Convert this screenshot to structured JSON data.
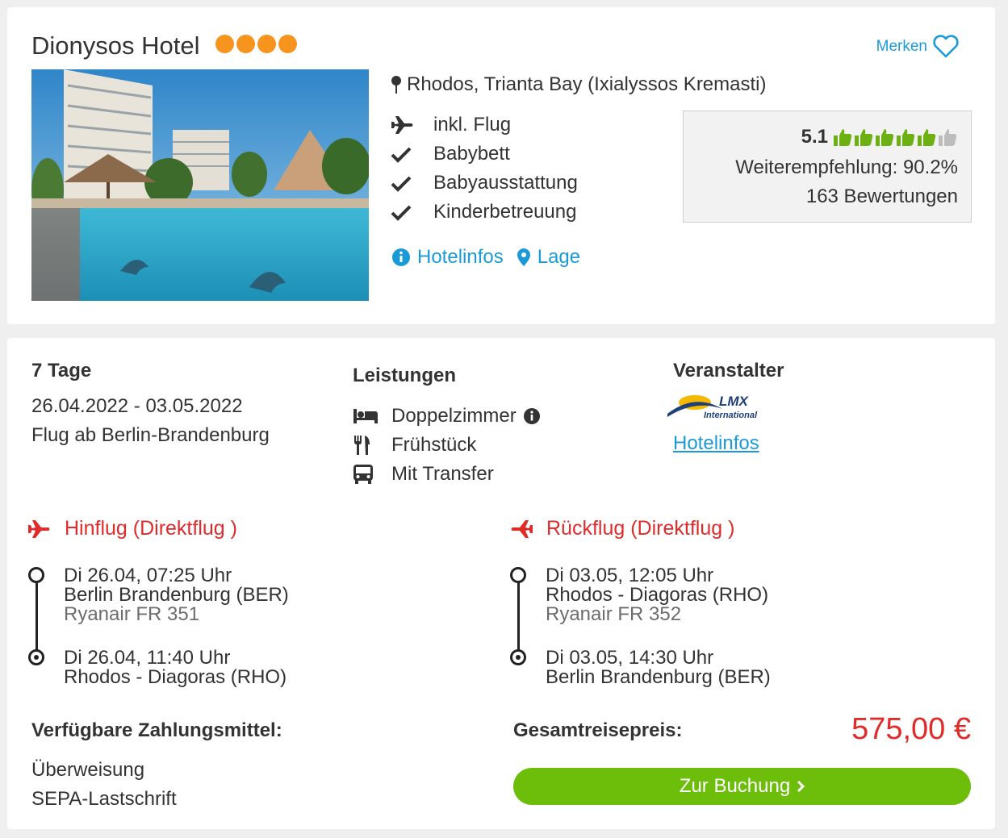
{
  "hotel": {
    "name": "Dionysos Hotel",
    "stars": 4,
    "merken_label": "Merken",
    "location": "Rhodos, Trianta Bay (Ixialyssos Kremasti)",
    "features": [
      "inkl. Flug",
      "Babybett",
      "Babyausstattung",
      "Kinderbetreuung"
    ],
    "feature_icons": [
      "plane-icon",
      "check-icon",
      "check-icon",
      "check-icon"
    ],
    "links": {
      "info": "Hotelinfos",
      "lage": "Lage"
    },
    "rating": {
      "score": "5.1",
      "thumbs_filled": 5,
      "thumbs_total": 6,
      "recommendation": "Weiterempfehlung: 90.2%",
      "reviews": "163 Bewertungen"
    }
  },
  "offer": {
    "duration": "7 Tage",
    "dates": "26.04.2022 - 03.05.2022",
    "departure": "Flug ab Berlin-Brandenburg",
    "leistungen_heading": "Leistungen",
    "leistungen": [
      "Doppelzimmer",
      "Frühstück",
      "Mit Transfer"
    ],
    "leistungen_icons": [
      "bed-icon",
      "cutlery-icon",
      "bus-icon"
    ],
    "veranstalter_heading": "Veranstalter",
    "veranstalter_logo_text": [
      "LMX",
      "International"
    ],
    "veranstalter_link": "Hotelinfos"
  },
  "flights": {
    "outbound": {
      "heading": "Hinflug (Direktflug )",
      "dep_time": "Di 26.04, 07:25 Uhr",
      "dep_airport": "Berlin Brandenburg (BER)",
      "carrier": "Ryanair FR 351",
      "arr_time": "Di 26.04, 11:40 Uhr",
      "arr_airport": "Rhodos - Diagoras (RHO)"
    },
    "return": {
      "heading": "Rückflug (Direktflug )",
      "dep_time": "Di 03.05, 12:05 Uhr",
      "dep_airport": "Rhodos - Diagoras (RHO)",
      "carrier": "Ryanair FR 352",
      "arr_time": "Di 03.05, 14:30 Uhr",
      "arr_airport": "Berlin Brandenburg (BER)"
    }
  },
  "payment": {
    "heading": "Verfügbare Zahlungsmittel:",
    "methods": [
      "Überweisung",
      "SEPA-Lastschrift"
    ]
  },
  "price": {
    "label": "Gesamtreisepreis:",
    "value": "575,00 €",
    "button": "Zur Buchung"
  },
  "colors": {
    "accent_blue": "#1a9bd7",
    "star_orange": "#f7941d",
    "price_red": "#e02b2b",
    "button_green": "#6cbe0b",
    "thumb_green": "#6cb014"
  }
}
